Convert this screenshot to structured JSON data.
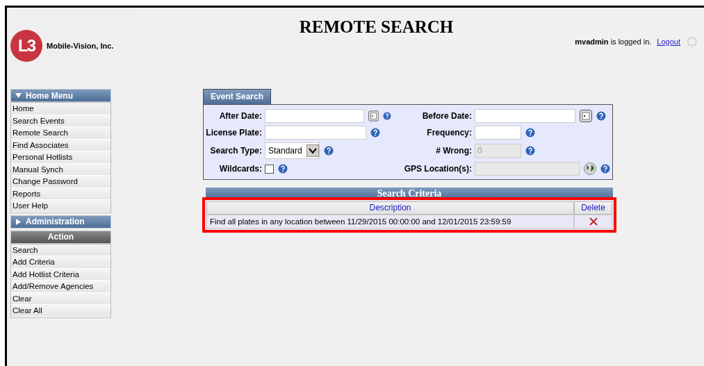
{
  "logo": {
    "mark": "L3",
    "company": "Mobile-Vision, Inc."
  },
  "page_title": "REMOTE SEARCH",
  "user": {
    "status": "**mvadmin** is logged in.",
    "logout": "Logout"
  },
  "sidebar": [
    {
      "kind": "menu",
      "title": "Home Menu",
      "expanded": true,
      "items": [
        "Home",
        "Search Events",
        "Remote Search",
        "Find Associates",
        "Personal Hotlists",
        "Manual Synch",
        "Change Password",
        "Reports",
        "User Help"
      ]
    },
    {
      "kind": "menu",
      "title": "Administration",
      "expanded": false
    },
    {
      "kind": "action",
      "title": "Action",
      "items": [
        "Search",
        "Add Criteria",
        "Add Hotlist Criteria",
        "Add/Remove Agencies",
        "Clear",
        "Clear All"
      ]
    }
  ],
  "event_search": {
    "tab": "Event Search",
    "fields": [
      {
        "label": "After Date:",
        "kind": "date"
      },
      {
        "label": "Before Date:",
        "kind": "date"
      },
      {
        "label": "License Plate:",
        "kind": "text"
      },
      {
        "label": "Frequency:",
        "kind": "short"
      },
      {
        "label": "Search Type:",
        "kind": "select",
        "value": "Standard"
      },
      {
        "label": "# Wrong:",
        "kind": "readonly",
        "value": "0"
      },
      {
        "label": "Wildcards:",
        "kind": "checkbox",
        "checked": false
      },
      {
        "label": "GPS Location(s):",
        "kind": "gps"
      }
    ]
  },
  "search_criteria": {
    "title": "Search Criteria",
    "columns": [
      "Description",
      "Delete"
    ],
    "rows": [
      {
        "description": "Find all plates in any location between 11/29/2015 00:00:00 and 12/01/2015 23:59:59"
      }
    ],
    "highlighted": true
  }
}
